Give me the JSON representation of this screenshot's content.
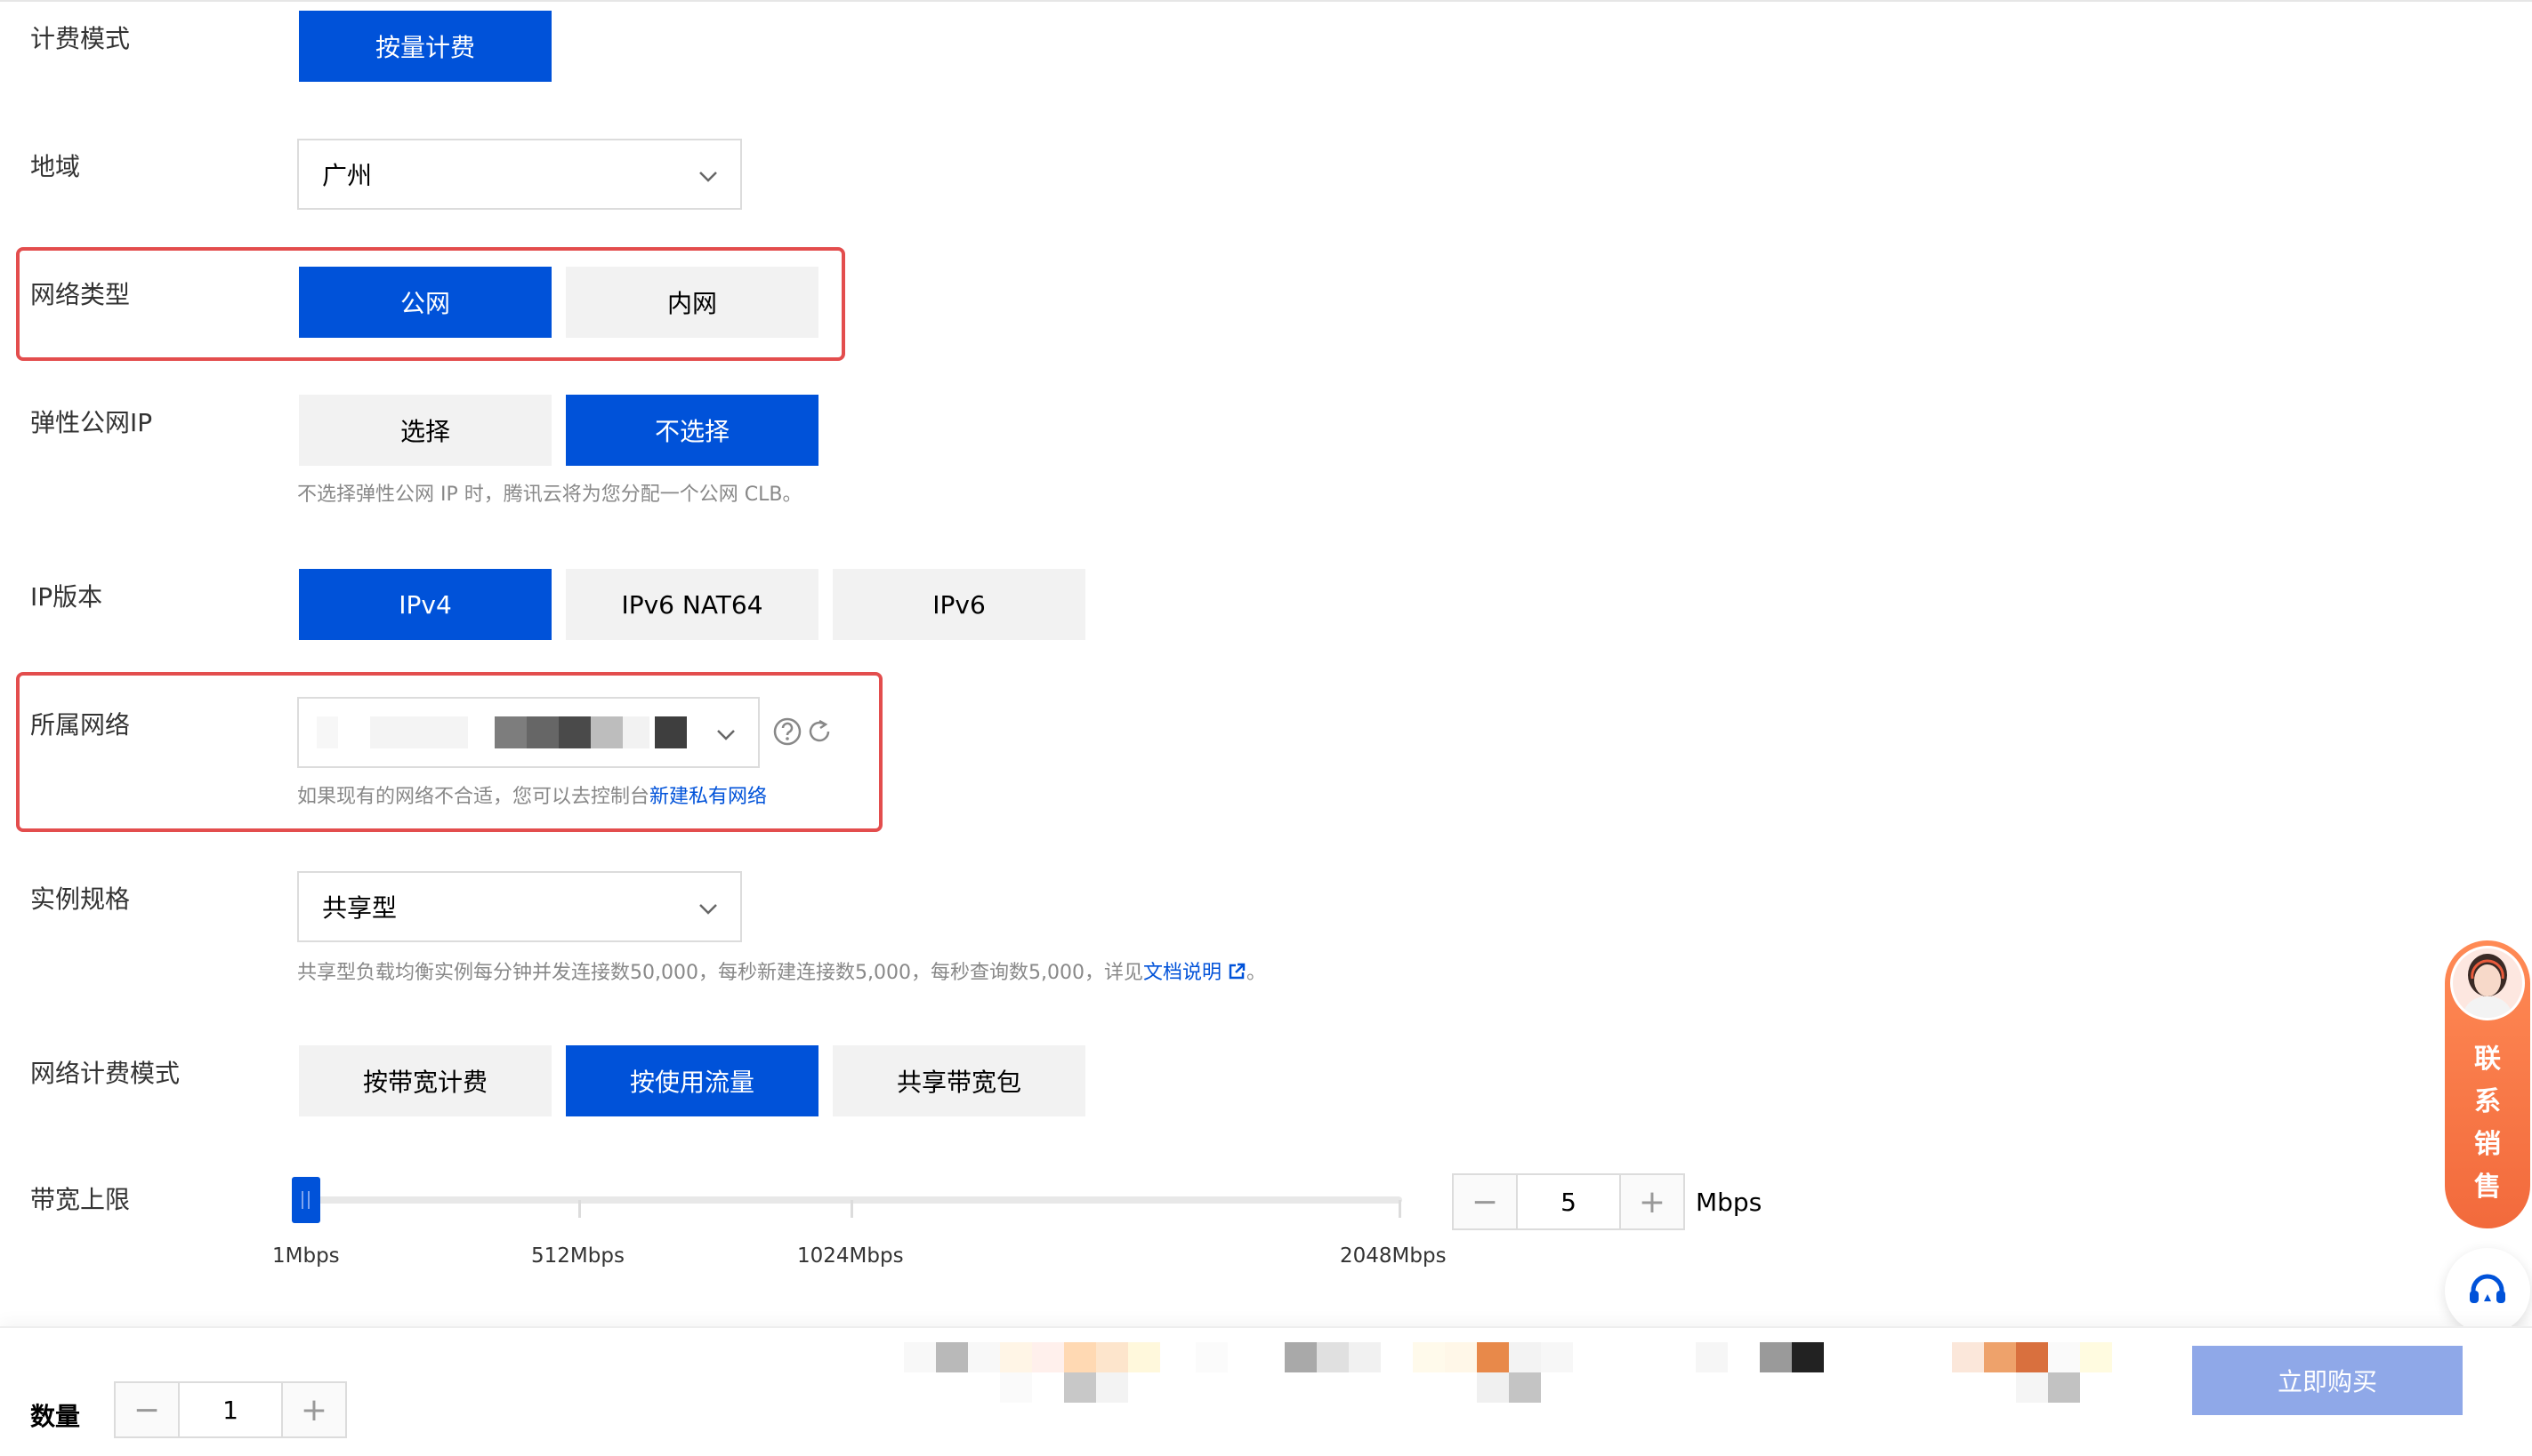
{
  "form": {
    "billing_mode": {
      "label": "计费模式",
      "option": "按量计费"
    },
    "region": {
      "label": "地域",
      "value": "广州"
    },
    "network_type": {
      "label": "网络类型",
      "options": [
        "公网",
        "内网"
      ]
    },
    "eip": {
      "label": "弹性公网IP",
      "options": [
        "选择",
        "不选择"
      ],
      "hint": "不选择弹性公网 IP 时，腾讯云将为您分配一个公网 CLB。"
    },
    "ip_version": {
      "label": "IP版本",
      "options": [
        "IPv4",
        "IPv6 NAT64",
        "IPv6"
      ]
    },
    "vpc": {
      "label": "所属网络",
      "hint_prefix": "如果现有的网络不合适，您可以去控制台",
      "hint_link": "新建私有网络"
    },
    "spec": {
      "label": "实例规格",
      "value": "共享型",
      "hint_prefix": "共享型负载均衡实例每分钟并发连接数50,000，每秒新建连接数5,000，每秒查询数5,000，详见",
      "hint_link": "文档说明",
      "hint_suffix": "。"
    },
    "net_billing": {
      "label": "网络计费模式",
      "options": [
        "按带宽计费",
        "按使用流量",
        "共享带宽包"
      ]
    },
    "bandwidth": {
      "label": "带宽上限",
      "ticks": [
        "1Mbps",
        "512Mbps",
        "1024Mbps",
        "2048Mbps"
      ],
      "value": "5",
      "unit": "Mbps",
      "minus": "−",
      "plus": "+"
    }
  },
  "footer": {
    "quantity_label": "数量",
    "quantity": "1",
    "minus": "−",
    "plus": "+",
    "buy_label": "立即购买"
  },
  "float": {
    "sales_chars": [
      "联",
      "系",
      "销",
      "售"
    ],
    "icons": {
      "avatar": "agent-avatar-icon",
      "support": "headset-icon"
    }
  },
  "colors": {
    "primary": "#0052d9",
    "highlight_border": "#e34d4d",
    "sales_bg": "#f26a3c"
  }
}
